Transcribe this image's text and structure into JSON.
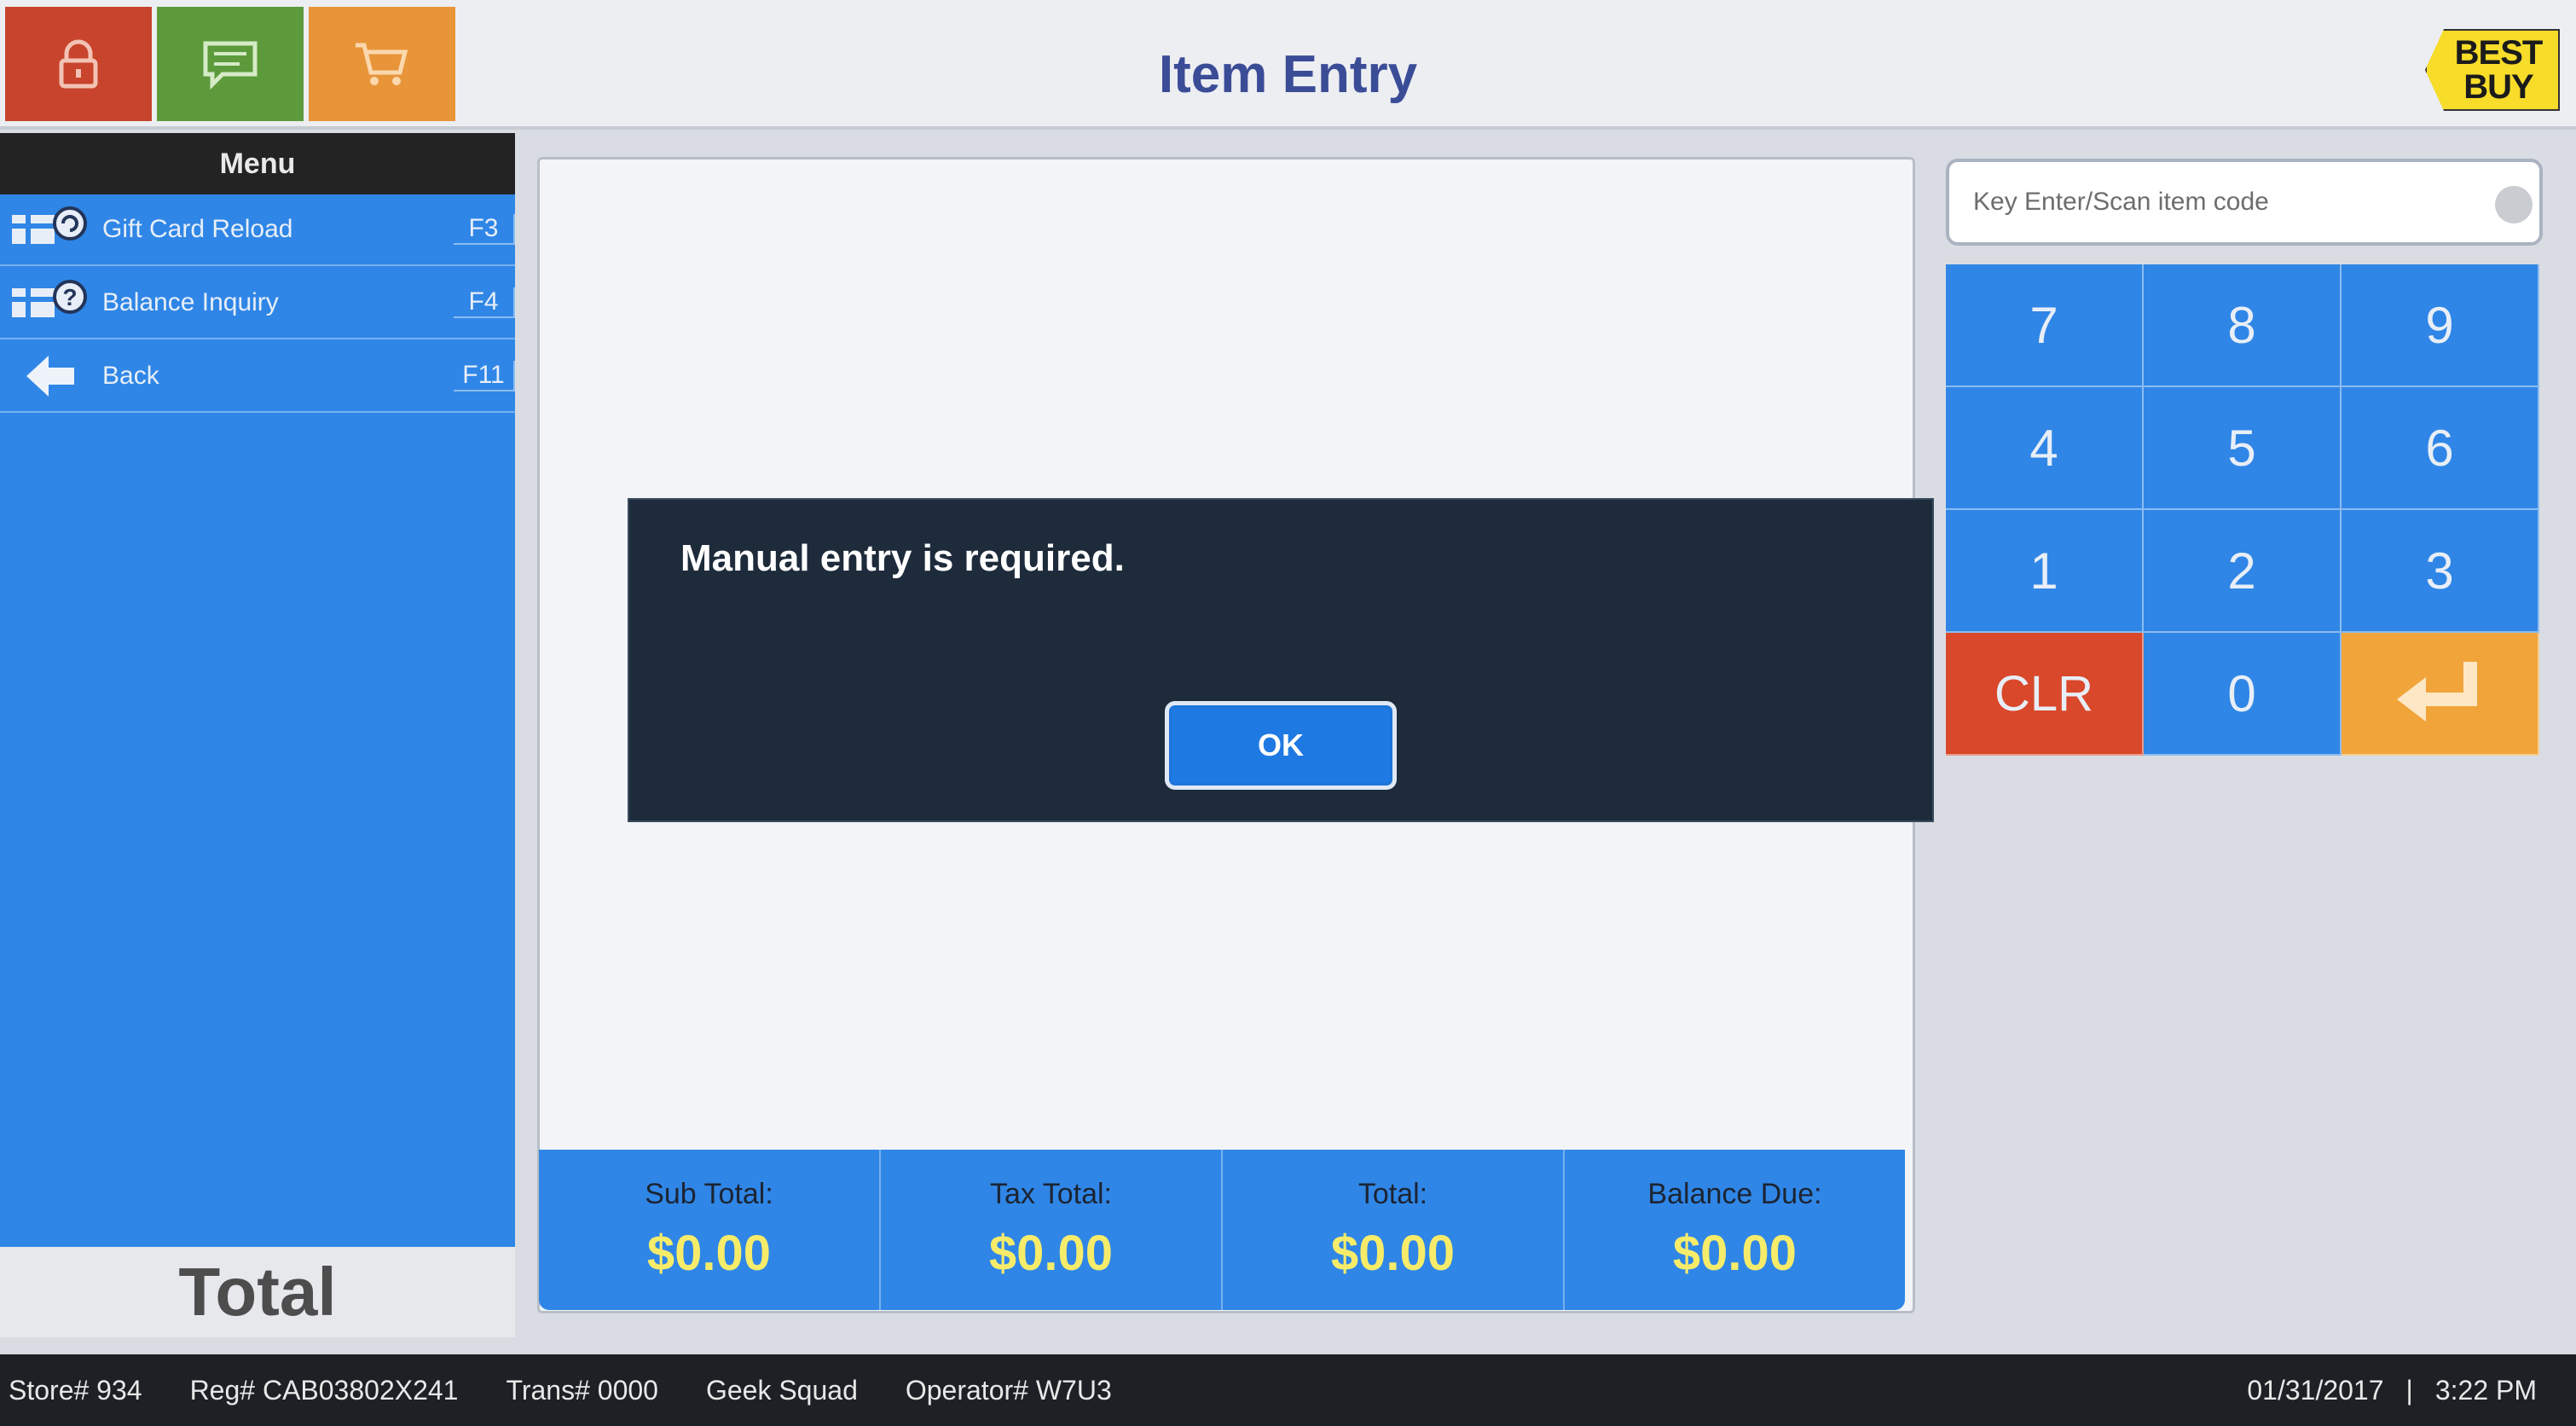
{
  "header": {
    "title": "Item Entry",
    "logo_text": [
      "BEST",
      "BUY"
    ],
    "colors": {
      "lock": "#c8442c",
      "message": "#5d9a3c",
      "cart": "#e8953a"
    }
  },
  "sidebar": {
    "menu_title": "Menu",
    "items": [
      {
        "label": "Gift Card Reload",
        "key": "F3",
        "icon": "gift-card-reload-icon"
      },
      {
        "label": "Balance Inquiry",
        "key": "F4",
        "icon": "balance-inquiry-icon"
      },
      {
        "label": "Back",
        "key": "F11",
        "icon": "back-arrow-icon"
      }
    ],
    "total_label": "Total"
  },
  "totals": [
    {
      "label": "Sub Total:",
      "value": "$0.00"
    },
    {
      "label": "Tax Total:",
      "value": "$0.00"
    },
    {
      "label": "Total:",
      "value": "$0.00"
    },
    {
      "label": "Balance Due:",
      "value": "$0.00"
    }
  ],
  "dialog": {
    "message": "Manual entry is required.",
    "ok_label": "OK"
  },
  "search": {
    "placeholder": "Key Enter/Scan item code",
    "value": ""
  },
  "keypad": [
    "7",
    "8",
    "9",
    "4",
    "5",
    "6",
    "1",
    "2",
    "3",
    "CLR",
    "0",
    "enter"
  ],
  "status": {
    "store": "Store# 934",
    "register": "Reg# CAB03802X241",
    "transaction": "Trans# 0000",
    "department": "Geek Squad",
    "operator": "Operator# W7U3",
    "date": "01/31/2017",
    "separator": "|",
    "time": "3:22 PM"
  }
}
